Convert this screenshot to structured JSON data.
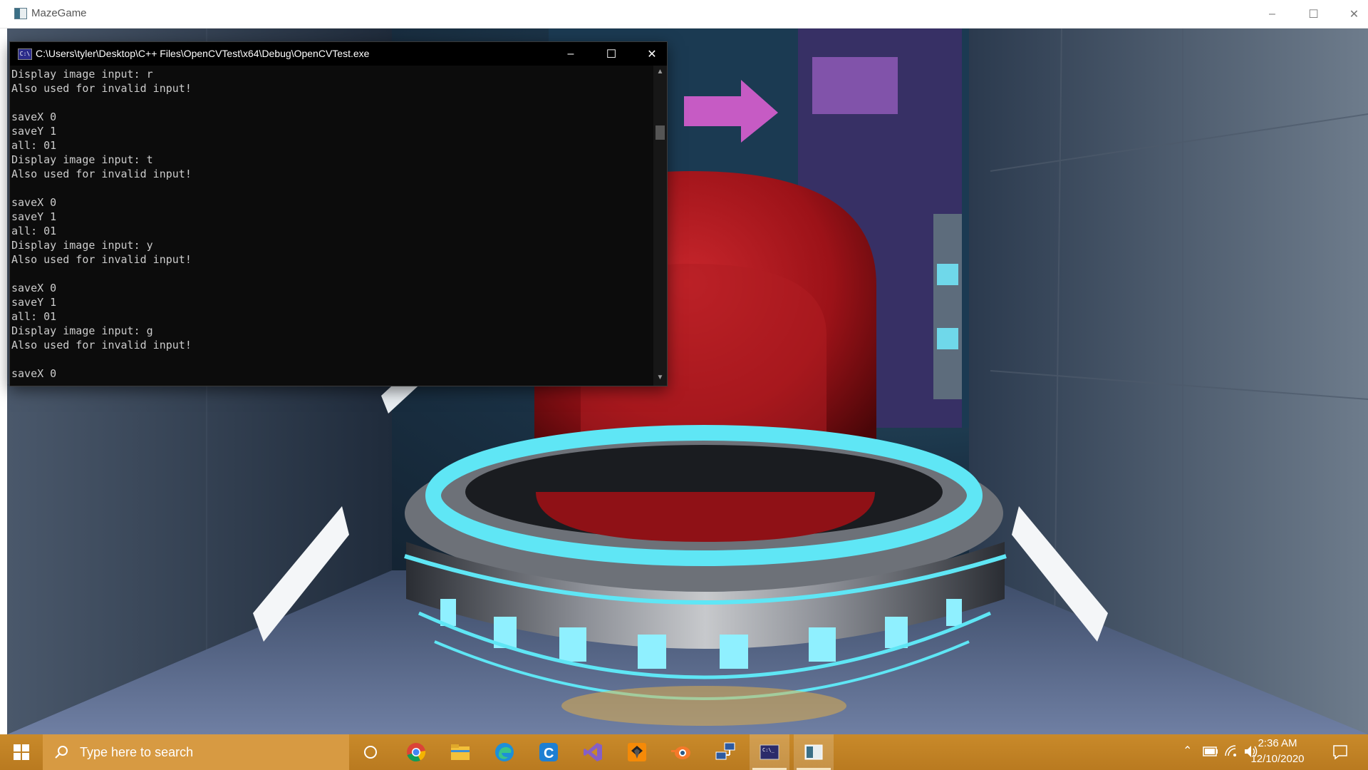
{
  "game_window": {
    "title": "MazeGame",
    "controls": {
      "minimize": "–",
      "maximize": "☐",
      "close": "✕"
    }
  },
  "console": {
    "title": "C:\\Users\\tyler\\Desktop\\C++ Files\\OpenCVTest\\x64\\Debug\\OpenCVTest.exe",
    "icon_text": "C:\\",
    "controls": {
      "minimize": "–",
      "maximize": "☐",
      "close": "✕"
    },
    "lines": [
      "Display image input: r",
      "Also used for invalid input!",
      "",
      "saveX 0",
      "saveY 1",
      "all: 01",
      "Display image input: t",
      "Also used for invalid input!",
      "",
      "saveX 0",
      "saveY 1",
      "all: 01",
      "Display image input: y",
      "Also used for invalid input!",
      "",
      "saveX 0",
      "saveY 1",
      "all: 01",
      "Display image input: g",
      "Also used for invalid input!",
      "",
      "saveX 0"
    ]
  },
  "taskbar": {
    "search_placeholder": "Type here to search",
    "apps": [
      {
        "name": "cortana-icon",
        "active": false
      },
      {
        "name": "chrome-icon",
        "active": false
      },
      {
        "name": "file-explorer-icon",
        "active": false
      },
      {
        "name": "edge-icon",
        "active": false
      },
      {
        "name": "ccleaner-icon",
        "active": false
      },
      {
        "name": "visual-studio-icon",
        "active": false
      },
      {
        "name": "sublime-text-icon",
        "active": false
      },
      {
        "name": "blender-icon",
        "active": false
      },
      {
        "name": "network-tool-icon",
        "active": false
      },
      {
        "name": "console-app-icon",
        "active": true
      },
      {
        "name": "mazegame-app-icon",
        "active": true
      }
    ],
    "clock_time": "2:36 AM",
    "clock_date": "12/10/2020"
  },
  "colors": {
    "taskbar": "#c98a2a",
    "console_bg": "#0c0c0c",
    "neon_cyan": "#5fe6f5",
    "arrow_magenta": "#c65bc4",
    "capsule_red": "#a8141a"
  }
}
